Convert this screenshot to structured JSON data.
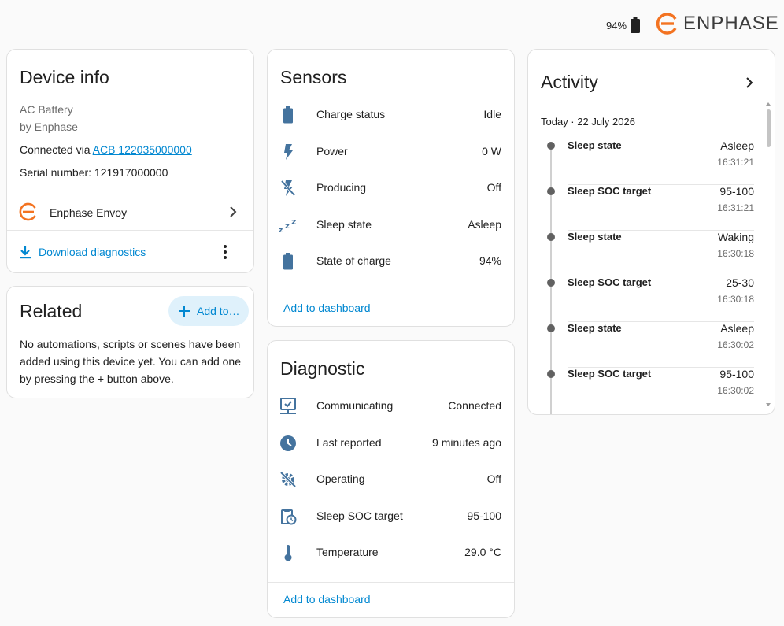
{
  "header": {
    "battery_percent": "94%",
    "brand": "ENPHASE"
  },
  "colors": {
    "accent": "#0288d1",
    "brand": "#f37321",
    "icon": "#44739e"
  },
  "device_info": {
    "title": "Device info",
    "model": "AC Battery",
    "manufacturer": "by Enphase",
    "connected_via_prefix": "Connected via ",
    "connected_via_link": "ACB 122035000000",
    "serial": "Serial number: 121917000000",
    "parent_device": "Enphase Envoy",
    "download_label": "Download diagnostics"
  },
  "related": {
    "title": "Related",
    "add_button": "Add to…",
    "text": "No automations, scripts or scenes have been added using this device yet. You can add one by pressing the + button above."
  },
  "sensors": {
    "title": "Sensors",
    "rows": [
      {
        "icon": "battery-icon",
        "label": "Charge status",
        "value": "Idle"
      },
      {
        "icon": "flash-icon",
        "label": "Power",
        "value": "0 W"
      },
      {
        "icon": "flash-off-icon",
        "label": "Producing",
        "value": "Off"
      },
      {
        "icon": "sleep-icon",
        "label": "Sleep state",
        "value": "Asleep"
      },
      {
        "icon": "battery-icon",
        "label": "State of charge",
        "value": "94%"
      }
    ],
    "add_to_dashboard": "Add to dashboard"
  },
  "diagnostic": {
    "title": "Diagnostic",
    "rows": [
      {
        "icon": "lan-connect-icon",
        "label": "Communicating",
        "value": "Connected"
      },
      {
        "icon": "clock-icon",
        "label": "Last reported",
        "value": "9 minutes ago"
      },
      {
        "icon": "cog-off-icon",
        "label": "Operating",
        "value": "Off"
      },
      {
        "icon": "clipboard-clock-icon",
        "label": "Sleep SOC target",
        "value": "95-100"
      },
      {
        "icon": "thermometer-icon",
        "label": "Temperature",
        "value": "29.0 °C"
      }
    ],
    "add_to_dashboard": "Add to dashboard"
  },
  "activity": {
    "title": "Activity",
    "date": "Today · 22 July 2026",
    "items": [
      {
        "name": "Sleep state",
        "state": "Asleep",
        "time": "16:31:21"
      },
      {
        "name": "Sleep SOC target",
        "state": "95-100",
        "time": "16:31:21"
      },
      {
        "name": "Sleep state",
        "state": "Waking",
        "time": "16:30:18"
      },
      {
        "name": "Sleep SOC target",
        "state": "25-30",
        "time": "16:30:18"
      },
      {
        "name": "Sleep state",
        "state": "Asleep",
        "time": "16:30:02"
      },
      {
        "name": "Sleep SOC target",
        "state": "95-100",
        "time": "16:30:02"
      }
    ]
  }
}
